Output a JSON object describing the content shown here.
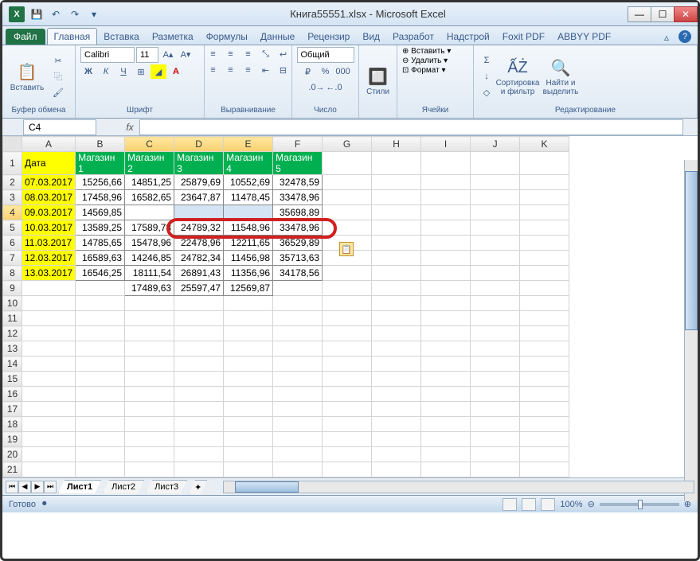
{
  "window": {
    "title": "Книга55551.xlsx - Microsoft Excel"
  },
  "qat": {
    "save": "💾",
    "undo": "↶",
    "redo": "↷"
  },
  "tabs": {
    "file": "Файл",
    "items": [
      "Главная",
      "Вставка",
      "Разметка",
      "Формулы",
      "Данные",
      "Рецензир",
      "Вид",
      "Разработ",
      "Надстрой",
      "Foxit PDF",
      "ABBYY PDF"
    ],
    "active_index": 0
  },
  "ribbon": {
    "clipboard": {
      "label": "Буфер обмена",
      "paste": "Вставить"
    },
    "font": {
      "label": "Шрифт",
      "name": "Calibri",
      "size": "11"
    },
    "align": {
      "label": "Выравнивание"
    },
    "number": {
      "label": "Число",
      "format": "Общий"
    },
    "styles": {
      "label": "Стили",
      "btn": "Стили"
    },
    "cells": {
      "label": "Ячейки",
      "insert": "Вставить",
      "delete": "Удалить",
      "format": "Формат"
    },
    "editing": {
      "label": "Редактирование",
      "sort": "Сортировка и фильтр",
      "find": "Найти и выделить"
    }
  },
  "formula_bar": {
    "name_box": "C4",
    "fx": "fx",
    "formula": ""
  },
  "grid": {
    "cols": [
      "A",
      "B",
      "C",
      "D",
      "E",
      "F",
      "G",
      "H",
      "I",
      "J",
      "K"
    ],
    "active_cols": [
      "C",
      "D",
      "E"
    ],
    "active_row": 4,
    "rows": [
      {
        "n": 1,
        "A": "Дата",
        "B": "Магазин 1",
        "C": "Магазин 2",
        "D": "Магазин 3",
        "E": "Магазин 4",
        "F": "Магазин 5",
        "header": true
      },
      {
        "n": 2,
        "A": "07.03.2017",
        "B": "15256,66",
        "C": "14851,25",
        "D": "25879,69",
        "E": "10552,69",
        "F": "32478,59"
      },
      {
        "n": 3,
        "A": "08.03.2017",
        "B": "17458,96",
        "C": "16582,65",
        "D": "23647,87",
        "E": "11478,45",
        "F": "33478,96"
      },
      {
        "n": 4,
        "A": "09.03.2017",
        "B": "14569,85",
        "C": "",
        "D": "",
        "E": "",
        "F": "35698,89",
        "sel": true
      },
      {
        "n": 5,
        "A": "10.03.2017",
        "B": "13589,25",
        "C": "17589,78",
        "D": "24789,32",
        "E": "11548,96",
        "F": "33478,96"
      },
      {
        "n": 6,
        "A": "11.03.2017",
        "B": "14785,65",
        "C": "15478,96",
        "D": "22478,96",
        "E": "12211,65",
        "F": "36529,89"
      },
      {
        "n": 7,
        "A": "12.03.2017",
        "B": "16589,63",
        "C": "14246,85",
        "D": "24782,34",
        "E": "11456,98",
        "F": "35713,63"
      },
      {
        "n": 8,
        "A": "13.03.2017",
        "B": "16546,25",
        "C": "18111,54",
        "D": "26891,43",
        "E": "11356,96",
        "F": "34178,56"
      },
      {
        "n": 9,
        "A": "",
        "B": "",
        "C": "17489,63",
        "D": "25597,47",
        "E": "12569,87",
        "F": ""
      },
      {
        "n": 10
      },
      {
        "n": 11
      },
      {
        "n": 12
      },
      {
        "n": 13
      },
      {
        "n": 14
      },
      {
        "n": 15
      },
      {
        "n": 16
      },
      {
        "n": 17
      },
      {
        "n": 18
      },
      {
        "n": 19
      },
      {
        "n": 20
      },
      {
        "n": 21
      }
    ]
  },
  "sheets": {
    "items": [
      "Лист1",
      "Лист2",
      "Лист3"
    ],
    "active_index": 0
  },
  "status": {
    "ready": "Готово",
    "zoom": "100%"
  }
}
